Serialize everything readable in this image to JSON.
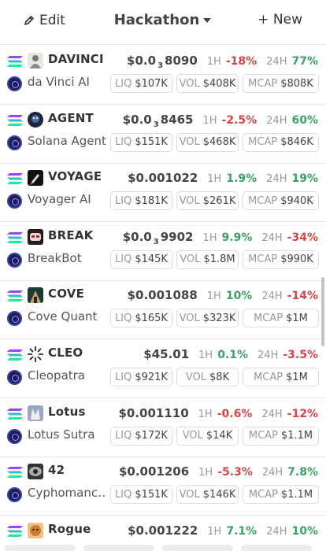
{
  "header": {
    "edit_label": "Edit",
    "title": "Hackathon",
    "new_label": "+ New"
  },
  "timeframes": {
    "short": "1H",
    "long": "24H"
  },
  "labels": {
    "liq": "LIQ",
    "vol": "VOL",
    "mcap": "MCAP"
  },
  "colors": {
    "positive": "#3aa266",
    "negative": "#d64545",
    "solana_top": "#9945ff",
    "solana_bottom": "#14f195"
  },
  "tokens": [
    {
      "ticker": "DAVINCI",
      "name": "da Vinci AI",
      "price_main": "$0.0",
      "price_sub": "3",
      "price_tail": "8090",
      "h1": "-18%",
      "h1_dir": "neg",
      "h24": "77%",
      "h24_dir": "pos",
      "liq": "$107K",
      "vol": "$408K",
      "mcap": "$808K",
      "avatar_icon": "statue-icon"
    },
    {
      "ticker": "AGENT",
      "name": "Solana Agent",
      "price_main": "$0.0",
      "price_sub": "3",
      "price_tail": "8465",
      "h1": "-2.5%",
      "h1_dir": "neg",
      "h24": "60%",
      "h24_dir": "pos",
      "liq": "$151K",
      "vol": "$468K",
      "mcap": "$846K",
      "avatar_icon": "robot-icon"
    },
    {
      "ticker": "VOYAGE",
      "name": "Voyager AI",
      "price_main": "$0.001022",
      "price_sub": "",
      "price_tail": "",
      "h1": "1.9%",
      "h1_dir": "pos",
      "h24": "19%",
      "h24_dir": "pos",
      "liq": "$181K",
      "vol": "$261K",
      "mcap": "$940K",
      "avatar_icon": "rocket-icon"
    },
    {
      "ticker": "BREAK",
      "name": "BreakBot",
      "price_main": "$0.0",
      "price_sub": "3",
      "price_tail": "9902",
      "h1": "9.9%",
      "h1_dir": "pos",
      "h24": "-34%",
      "h24_dir": "neg",
      "liq": "$145K",
      "vol": "$1.8M",
      "mcap": "$990K",
      "avatar_icon": "bot-face-icon"
    },
    {
      "ticker": "COVE",
      "name": "Cove Quant",
      "price_main": "$0.001088",
      "price_sub": "",
      "price_tail": "",
      "h1": "10%",
      "h1_dir": "pos",
      "h24": "-14%",
      "h24_dir": "neg",
      "liq": "$165K",
      "vol": "$323K",
      "mcap": "$1M",
      "avatar_icon": "cave-icon"
    },
    {
      "ticker": "CLEO",
      "name": "Cleopatra",
      "price_main": "$45.01",
      "price_sub": "",
      "price_tail": "",
      "h1": "0.1%",
      "h1_dir": "pos",
      "h24": "-3.5%",
      "h24_dir": "neg",
      "liq": "$921K",
      "vol": "$8K",
      "mcap": "$1M",
      "avatar_icon": "sunburst-icon"
    },
    {
      "ticker": "Lotus",
      "name": "Lotus Sutra",
      "price_main": "$0.001110",
      "price_sub": "",
      "price_tail": "",
      "h1": "-0.6%",
      "h1_dir": "neg",
      "h24": "-12%",
      "h24_dir": "neg",
      "liq": "$172K",
      "vol": "$14K",
      "mcap": "$1.1M",
      "avatar_icon": "lotus-icon"
    },
    {
      "ticker": "42",
      "name": "Cyphomanc…",
      "price_main": "$0.001206",
      "price_sub": "",
      "price_tail": "",
      "h1": "-5.3%",
      "h1_dir": "neg",
      "h24": "7.8%",
      "h24_dir": "pos",
      "liq": "$151K",
      "vol": "$146K",
      "mcap": "$1.1M",
      "avatar_icon": "eye-icon"
    },
    {
      "ticker": "Rogue",
      "name": "",
      "price_main": "$0.001222",
      "price_sub": "",
      "price_tail": "",
      "h1": "7.1%",
      "h1_dir": "pos",
      "h24": "10%",
      "h24_dir": "pos",
      "liq": "",
      "vol": "",
      "mcap": "",
      "avatar_icon": "face-icon"
    }
  ]
}
